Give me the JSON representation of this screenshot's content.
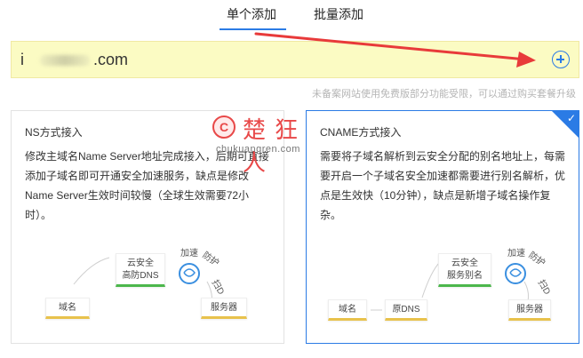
{
  "tabs": {
    "single": "单个添加",
    "batch": "批量添加"
  },
  "domain": {
    "visible_prefix": "i",
    "suffix": ".com"
  },
  "notice": "未备案网站使用免费版部分功能受限，可以通过购买套餐升级",
  "ns_card": {
    "title": "NS方式接入",
    "description": "修改主域名Name Server地址完成接入，后期可直接添加子域名即可开通安全加速服务，缺点是修改Name Server生效时间较慢（全球生效需要72小时）。",
    "diagram": {
      "domain": "域名",
      "dns": "云安全\n高防DNS",
      "server": "服务器",
      "accel": "加速",
      "protect": "防护",
      "extra": "扫D"
    }
  },
  "cname_card": {
    "title": "CNAME方式接入",
    "description": "需要将子域名解析到云安全分配的别名地址上，每需要开启一个子域名安全加速都需要进行别名解析，优点是生效快（10分钟），缺点是新增子域名操作复杂。",
    "diagram": {
      "domain": "域名",
      "origin_dns": "原DNS",
      "alias": "云安全\n服务别名",
      "server": "服务器",
      "accel": "加速",
      "protect": "防护",
      "extra": "扫D"
    },
    "selected": true
  },
  "watermark": {
    "logo": "C",
    "text": "楚狂人",
    "sub": "chukuangren.com"
  },
  "colors": {
    "accent": "#2b7be5",
    "input_bg": "#fbfbc3",
    "arrow": "#e83a3a"
  }
}
